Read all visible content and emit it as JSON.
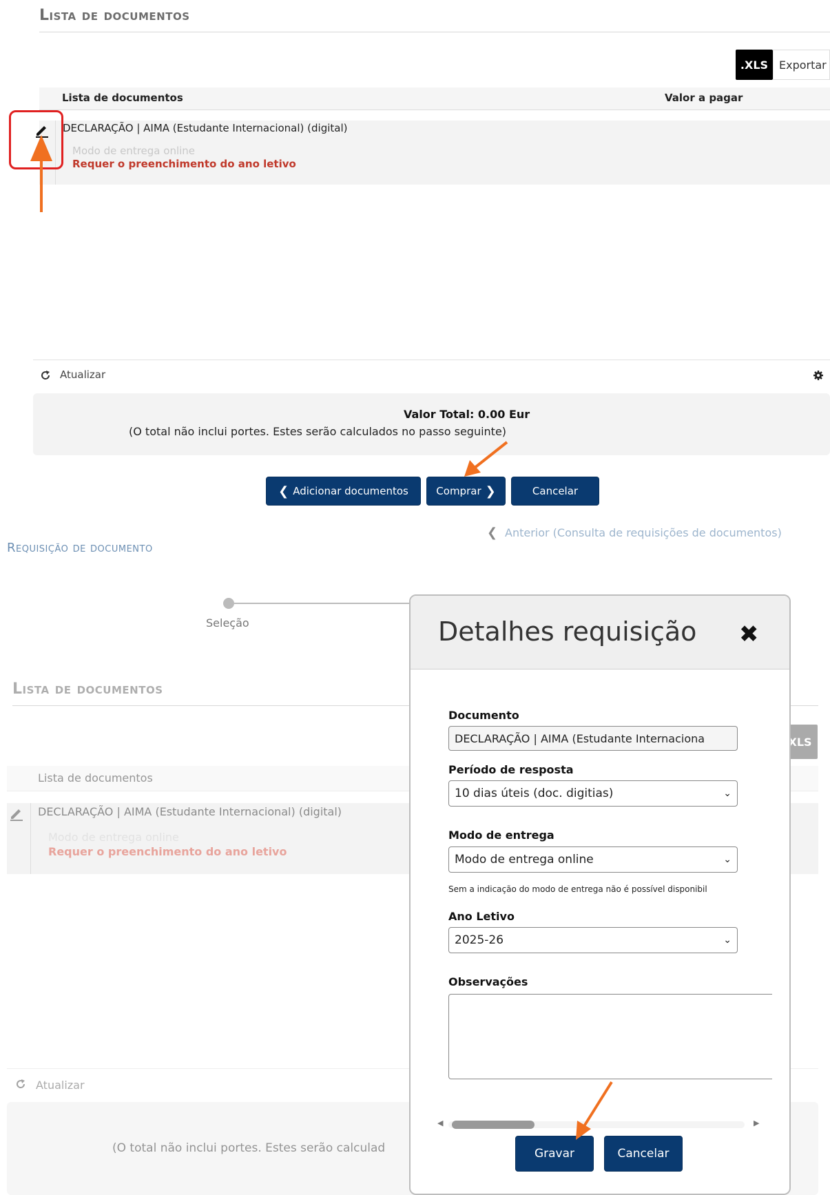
{
  "top": {
    "heading": "Lista de documentos",
    "xls_badge": ".XLS",
    "export_label": "Exportar",
    "table_head": {
      "col_doc": "Lista de documentos",
      "col_value": "Valor a pagar"
    },
    "row": {
      "title": "DECLARAÇÃO | AIMA (Estudante Internacional) (digital)",
      "delivery": "Modo de entrega online",
      "warning": "Requer o preenchimento do ano letivo"
    },
    "refresh_label": "Atualizar",
    "total_label": "Valor Total: 0.00 Eur",
    "total_note": "(O total não inclui portes. Estes serão calculados no passo seguinte)",
    "buttons": {
      "add": "Adicionar documentos",
      "buy": "Comprar",
      "cancel": "Cancelar"
    }
  },
  "nav": {
    "previous": "Anterior (Consulta de requisições de documentos)",
    "page_title": "Requisição de documento",
    "step1": "Seleção"
  },
  "bottom": {
    "heading": "Lista de documentos",
    "xls_badge": ".XLS",
    "col_doc": "Lista de documentos",
    "row_title": "DECLARAÇÃO | AIMA (Estudante Internacional) (digital)",
    "row_delivery": "Modo de entrega online",
    "row_warning": "Requer o preenchimento do ano letivo",
    "refresh_label": "Atualizar",
    "total_note": "(O total não inclui portes. Estes serão calculad"
  },
  "modal": {
    "title": "Detalhes requisição",
    "fields": {
      "document_label": "Documento",
      "document_value": "DECLARAÇÃO | AIMA (Estudante Internaciona",
      "period_label": "Período de resposta",
      "period_value": "10 dias úteis (doc. digitias)",
      "delivery_label": "Modo de entrega",
      "delivery_value": "Modo de entrega online",
      "delivery_note": "Sem a indicação do modo de entrega não é possível disponibil",
      "year_label": "Ano Letivo",
      "year_value": "2025-26",
      "notes_label": "Observações"
    },
    "buttons": {
      "save": "Gravar",
      "cancel": "Cancelar"
    }
  },
  "colors": {
    "primary_button": "#0a3a70",
    "warning_text": "#c0392b",
    "annotation_arrow": "#f07020",
    "highlight_box": "#e02020"
  }
}
